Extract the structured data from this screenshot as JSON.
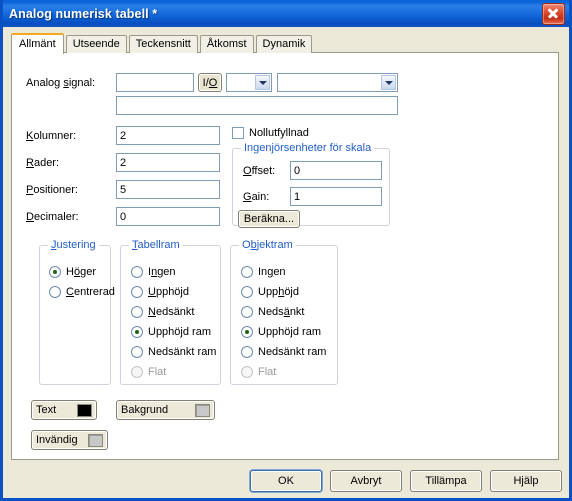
{
  "window": {
    "title": "Analog numerisk tabell *",
    "close_icon": "close-icon"
  },
  "tabs": [
    {
      "label": "Allmänt",
      "active": true
    },
    {
      "label": "Utseende",
      "active": false
    },
    {
      "label": "Teckensnitt",
      "active": false
    },
    {
      "label": "Åtkomst",
      "active": false
    },
    {
      "label": "Dynamik",
      "active": false
    }
  ],
  "signal": {
    "label": "Analog signal:",
    "name_value": "",
    "io_button": "I/O",
    "type_combo_value": "",
    "detail_combo_value": "",
    "description_value": ""
  },
  "fields": [
    {
      "label": "Kolumner:",
      "value": "2"
    },
    {
      "label": "Rader:",
      "value": "2"
    },
    {
      "label": "Positioner:",
      "value": "5"
    },
    {
      "label": "Decimaler:",
      "value": "0"
    }
  ],
  "zero_fill": {
    "label": "Nollutfyllnad",
    "checked": false
  },
  "scale_group": {
    "title": "Ingenjörsenheter för skala",
    "offset_label": "Offset:",
    "offset_value": "0",
    "gain_label": "Gain:",
    "gain_value": "1",
    "calc_button": "Beräkna..."
  },
  "justering": {
    "title": "Justering",
    "options": [
      {
        "label": "Höger",
        "checked": true,
        "disabled": false
      },
      {
        "label": "Centrerad",
        "checked": false,
        "disabled": false
      }
    ]
  },
  "tabellram": {
    "title": "Tabellram",
    "options": [
      {
        "label": "Ingen",
        "checked": false,
        "disabled": false
      },
      {
        "label": "Upphöjd",
        "checked": false,
        "disabled": false
      },
      {
        "label": "Nedsänkt",
        "checked": false,
        "disabled": false
      },
      {
        "label": "Upphöjd ram",
        "checked": true,
        "disabled": false
      },
      {
        "label": "Nedsänkt ram",
        "checked": false,
        "disabled": false
      },
      {
        "label": "Flat",
        "checked": false,
        "disabled": true
      }
    ]
  },
  "objektram": {
    "title": "Objektram",
    "options": [
      {
        "label": "Ingen",
        "checked": false,
        "disabled": false
      },
      {
        "label": "Upphöjd",
        "checked": false,
        "disabled": false
      },
      {
        "label": "Nedsänkt",
        "checked": false,
        "disabled": false
      },
      {
        "label": "Upphöjd ram",
        "checked": true,
        "disabled": false
      },
      {
        "label": "Nedsänkt ram",
        "checked": false,
        "disabled": false
      },
      {
        "label": "Flat",
        "checked": false,
        "disabled": true
      }
    ]
  },
  "color_buttons": [
    {
      "label": "Text",
      "color": "#000000"
    },
    {
      "label": "Bakgrund",
      "color": "#c8c8c8"
    },
    {
      "label": "Invändig",
      "color": "#c8c8c8"
    }
  ],
  "footer": {
    "ok": "OK",
    "cancel": "Avbryt",
    "apply": "Tillämpa",
    "help": "Hjälp"
  }
}
